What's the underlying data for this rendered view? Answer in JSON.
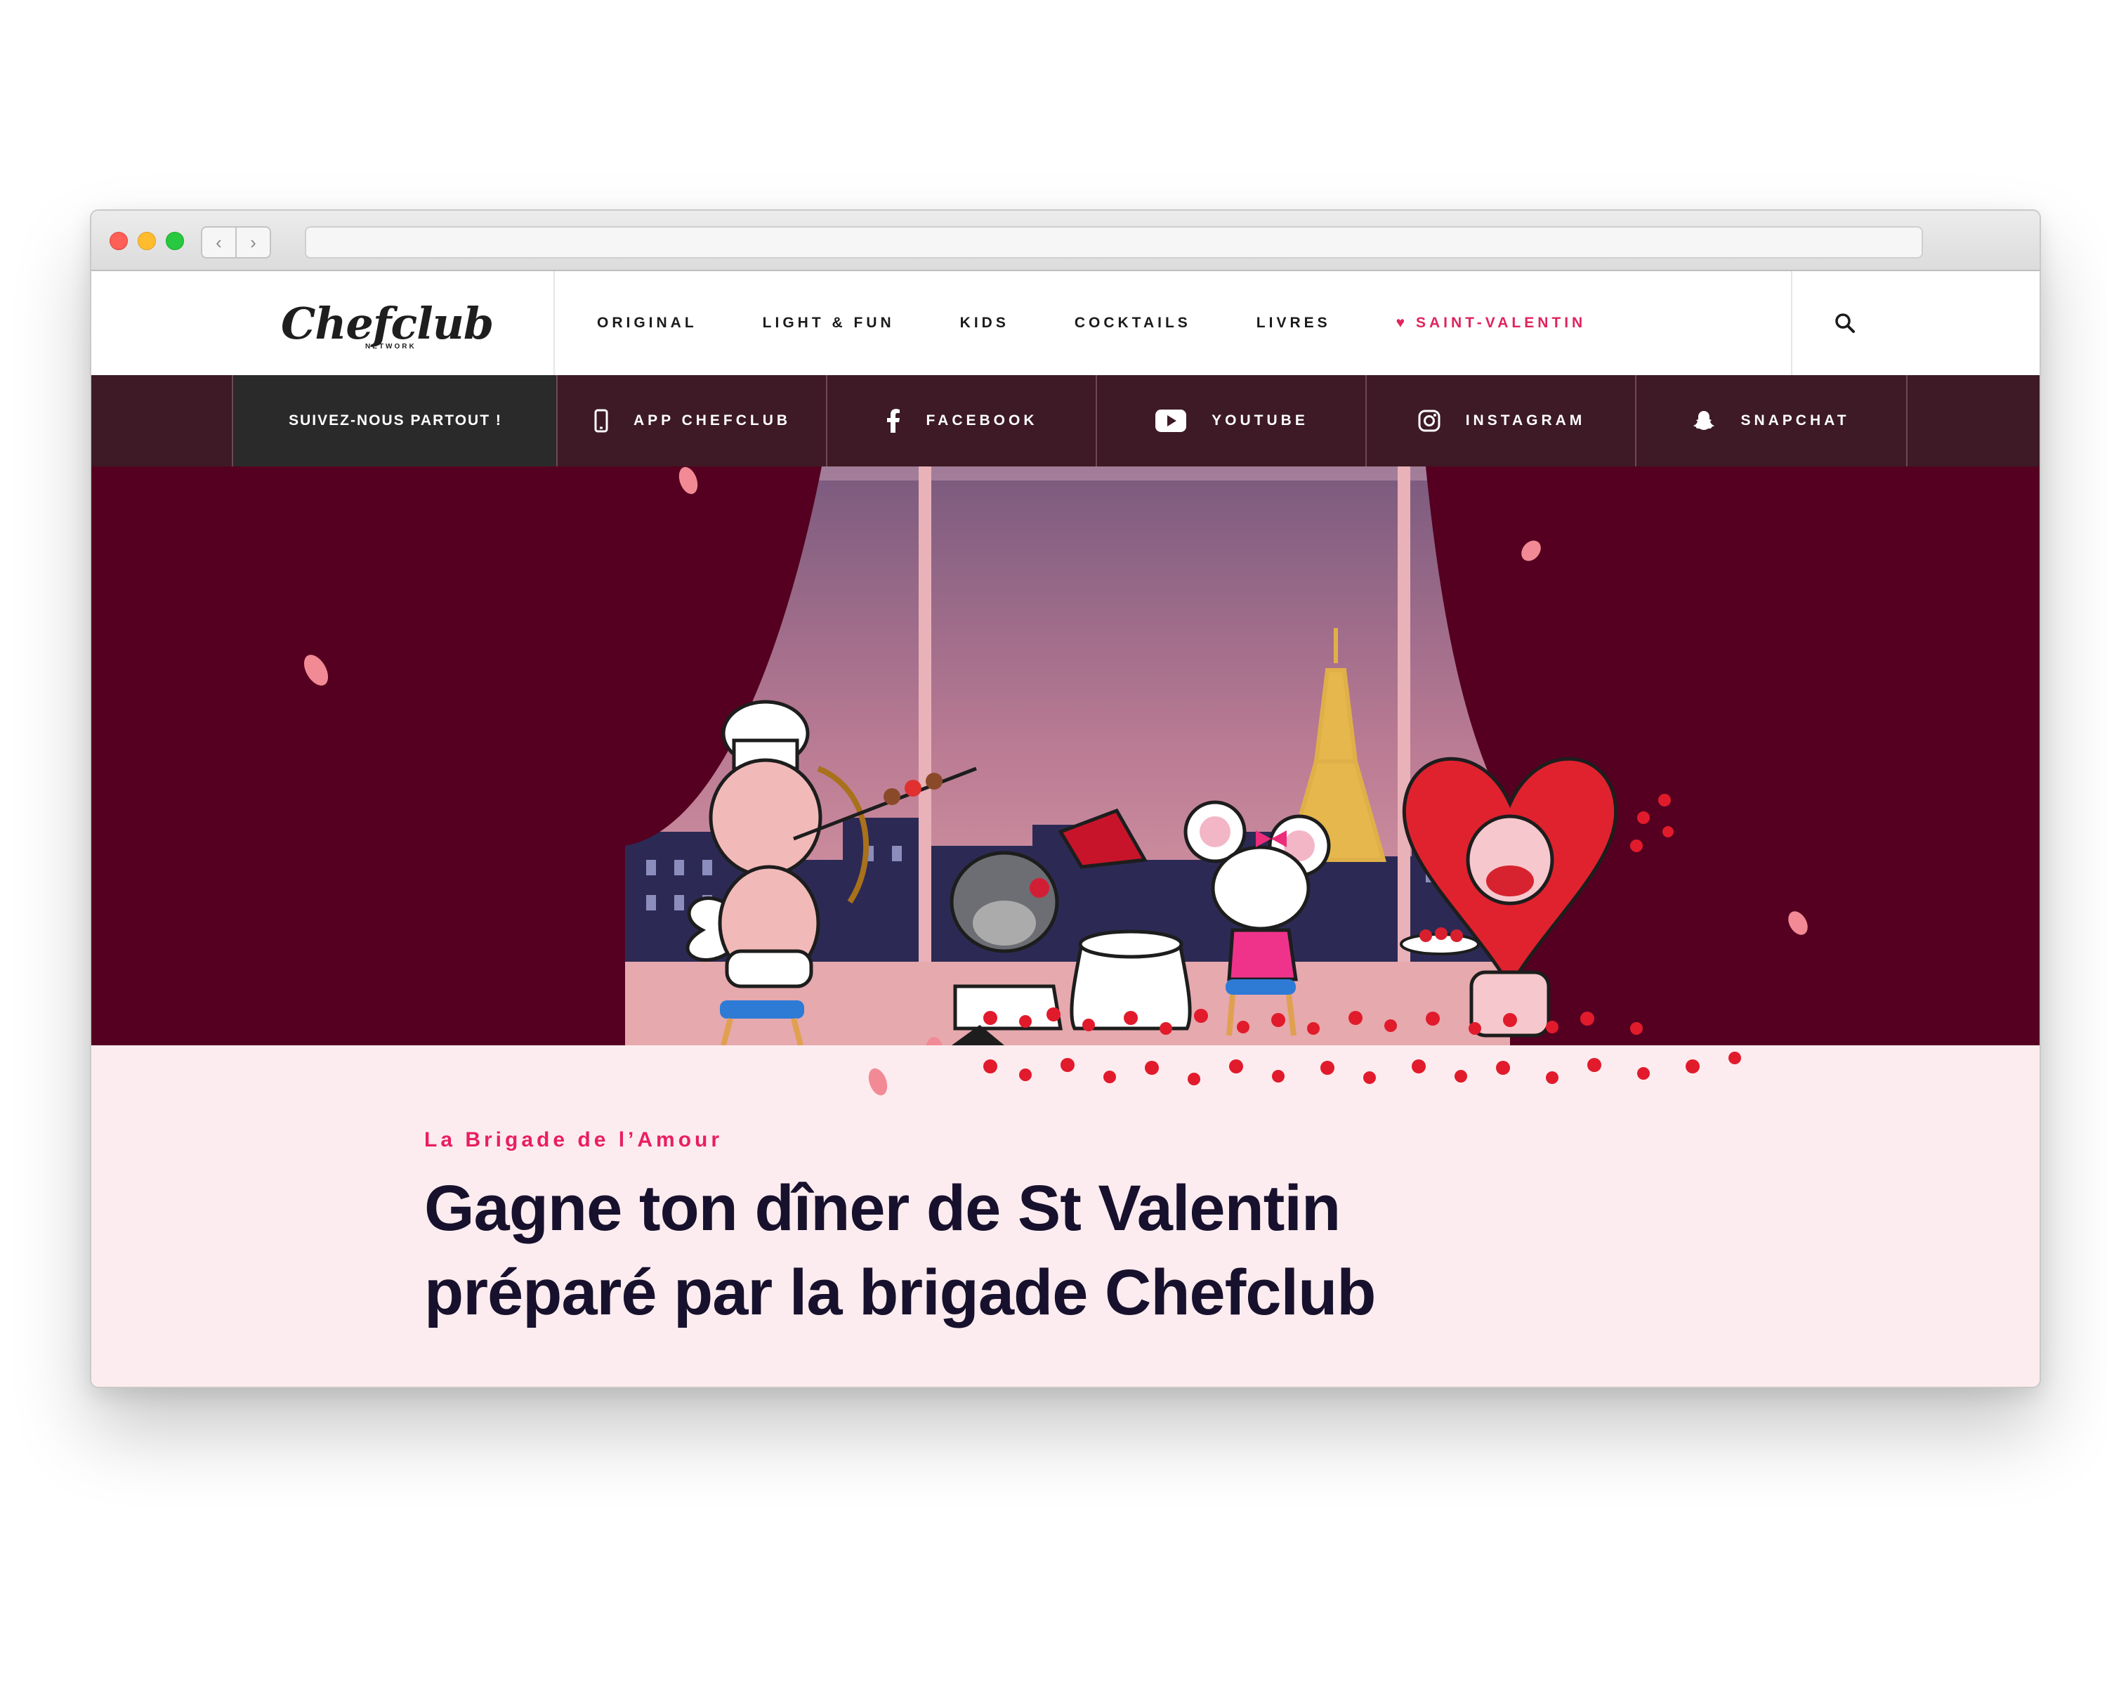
{
  "browser": {
    "back_glyph": "‹",
    "forward_glyph": "›",
    "url": ""
  },
  "header": {
    "logo_text": "Chefclub",
    "logo_sub": "NETWORK",
    "nav": [
      {
        "label": "ORIGINAL"
      },
      {
        "label": "LIGHT & FUN"
      },
      {
        "label": "KIDS"
      },
      {
        "label": "COCKTAILS"
      },
      {
        "label": "LIVRES"
      },
      {
        "label": "♥ SAINT-VALENTIN",
        "highlight": true
      }
    ],
    "search_icon": "search-icon"
  },
  "social_bar": {
    "lead": "SUIVEZ-NOUS PARTOUT !",
    "items": [
      {
        "label": "APP CHEFCLUB",
        "icon": "phone-icon"
      },
      {
        "label": "FACEBOOK",
        "icon": "facebook-icon"
      },
      {
        "label": "YOUTUBE",
        "icon": "youtube-icon"
      },
      {
        "label": "INSTAGRAM",
        "icon": "instagram-icon"
      },
      {
        "label": "SNAPCHAT",
        "icon": "snapchat-icon"
      }
    ]
  },
  "hero": {
    "kicker": "La Brigade de l’Amour",
    "headline_line1": "Gagne ton dîner de St Valentin",
    "headline_line2": "préparé par la brigade Chefclub"
  },
  "colors": {
    "accent": "#e0245e",
    "hero_bg": "#550020",
    "social_bg": "#3d1a25",
    "floor": "#fdecef",
    "headline": "#17112d"
  }
}
